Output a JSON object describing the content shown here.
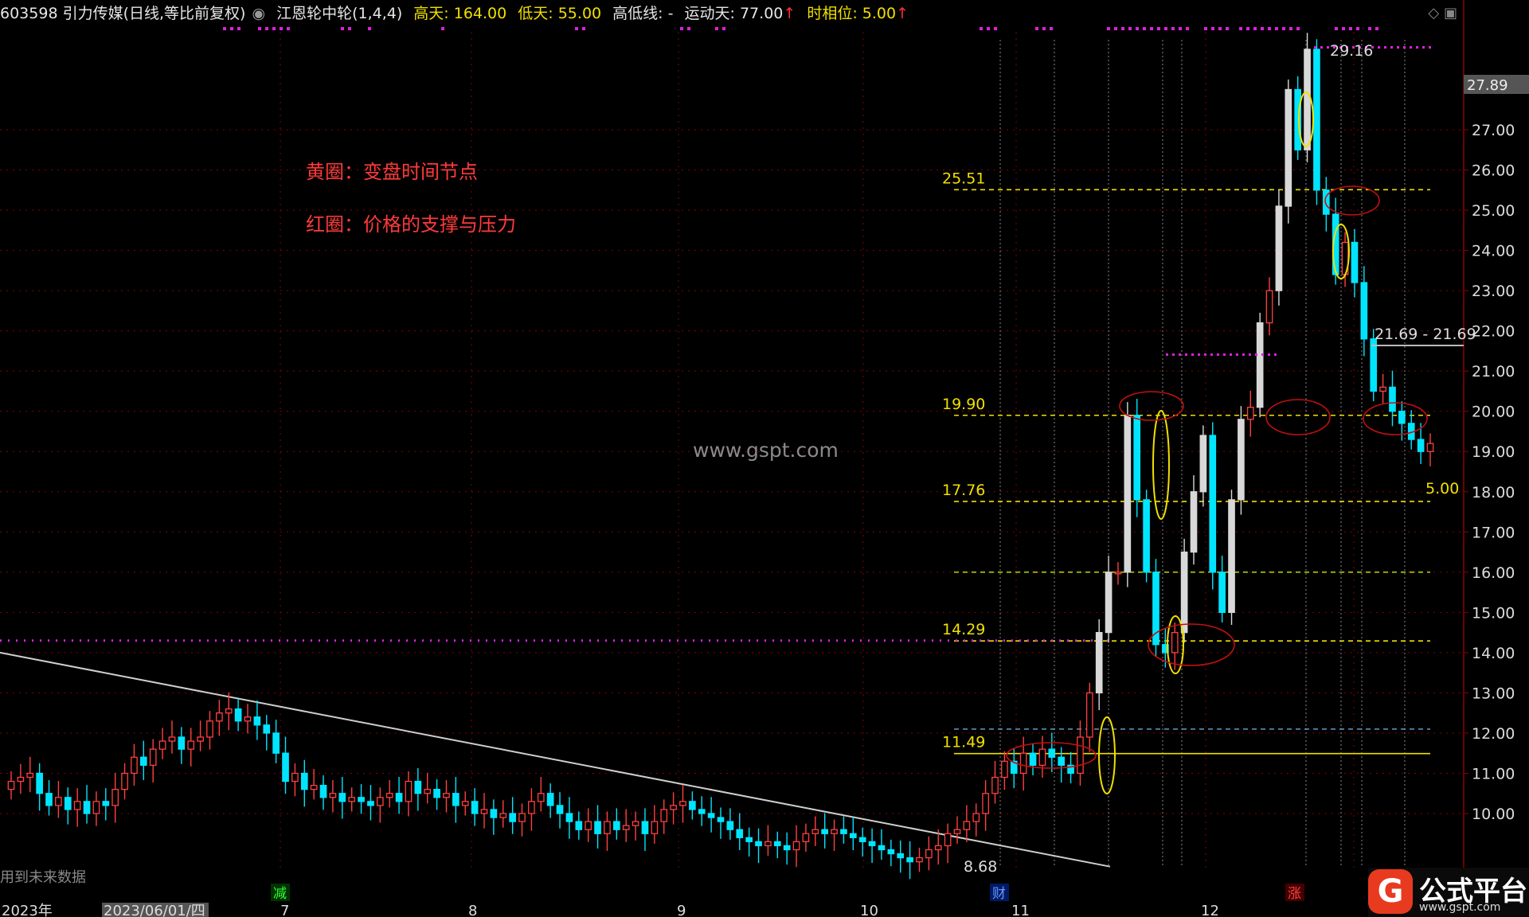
{
  "header": {
    "code_name": "603598 引力传媒(日线,等比前复权)",
    "indicator": "江恩轮中轮(1,4,4)",
    "high_days": "高天: 164.00",
    "low_days": "低天: 55.00",
    "hl_line": "高低线: -",
    "move_days": "运动天: 77.00",
    "time_phase": "时相位: 5.00",
    "arrow": "↑"
  },
  "annotations": {
    "yellow_circle": "黄圈：变盘时间节点",
    "red_circle": "红圈：价格的支撑与压力",
    "watermark": "www.gspt.com",
    "future_data": "用到未来数据",
    "price_high": "29.16",
    "price_low": "8.68",
    "range_label": "21.69 - 21.69",
    "current_price_tag": "27.89",
    "phase_value": "5.00"
  },
  "markers": {
    "jian": "减",
    "cai": "财",
    "zhang": "涨"
  },
  "logo": {
    "mark": "G",
    "name": "公式平台",
    "url": "www.gspt.com"
  },
  "colors": {
    "up": "#ff4040",
    "down": "#00e5ff",
    "yellow": "#f0e000",
    "magenta": "#e020e0",
    "grid": "#8a0000"
  },
  "chart_data": {
    "type": "candlestick",
    "x_labels": [
      "2023年",
      "2023/06/01/四",
      "7",
      "8",
      "9",
      "10",
      "11",
      "12"
    ],
    "y_ticks": [
      10.0,
      11.0,
      12.0,
      13.0,
      14.0,
      15.0,
      16.0,
      17.0,
      18.0,
      19.0,
      20.0,
      21.0,
      22.0,
      23.0,
      24.0,
      25.0,
      26.0,
      27.0
    ],
    "ylim": [
      9.3,
      29.6
    ],
    "levels": [
      {
        "label": "25.51",
        "value": 25.51
      },
      {
        "label": "19.90",
        "value": 19.9
      },
      {
        "label": "17.76",
        "value": 17.76
      },
      {
        "label": "14.29",
        "value": 14.29
      },
      {
        "label": "11.49",
        "value": 11.49
      }
    ],
    "trendline": [
      {
        "x": 0,
        "y": 14.0
      },
      {
        "x": 117,
        "y": 8.68
      }
    ],
    "closes": [
      10.8,
      10.9,
      11.0,
      10.5,
      10.2,
      10.4,
      10.1,
      10.3,
      10.0,
      10.3,
      10.2,
      10.6,
      11.0,
      11.4,
      11.2,
      11.6,
      11.8,
      11.9,
      11.6,
      11.8,
      11.9,
      12.3,
      12.5,
      12.6,
      12.3,
      12.4,
      12.2,
      12.0,
      11.5,
      10.8,
      11.0,
      10.6,
      10.7,
      10.4,
      10.5,
      10.3,
      10.4,
      10.3,
      10.2,
      10.4,
      10.5,
      10.3,
      10.8,
      10.5,
      10.6,
      10.4,
      10.5,
      10.2,
      10.3,
      10.0,
      10.1,
      9.9,
      10.0,
      9.8,
      10.0,
      10.3,
      10.5,
      10.2,
      10.0,
      9.8,
      9.6,
      9.8,
      9.5,
      9.8,
      9.6,
      9.7,
      9.8,
      9.5,
      9.8,
      10.1,
      10.2,
      10.3,
      10.1,
      10.0,
      9.9,
      9.8,
      9.6,
      9.4,
      9.3,
      9.2,
      9.3,
      9.2,
      9.1,
      9.3,
      9.5,
      9.6,
      9.5,
      9.6,
      9.5,
      9.4,
      9.3,
      9.2,
      9.1,
      9.0,
      8.9,
      8.8,
      8.9,
      9.1,
      9.2,
      9.5,
      9.6,
      9.8,
      10.0,
      10.5,
      10.9,
      11.3,
      11.0,
      11.5,
      11.2,
      11.6,
      11.4,
      11.2,
      11.0,
      11.9,
      13.0,
      14.5,
      16.0,
      16.0,
      19.9,
      17.8,
      16.0,
      14.2,
      14.0,
      14.5,
      16.5,
      18.0,
      19.4,
      16.0,
      15.0,
      17.8,
      19.8,
      20.1,
      22.2,
      23.0,
      25.1,
      28.0,
      26.5,
      29.0,
      25.5,
      24.9,
      23.4,
      24.2,
      23.2,
      21.8,
      20.5,
      20.6,
      20.0,
      19.7,
      19.3,
      19.0,
      19.2
    ]
  }
}
